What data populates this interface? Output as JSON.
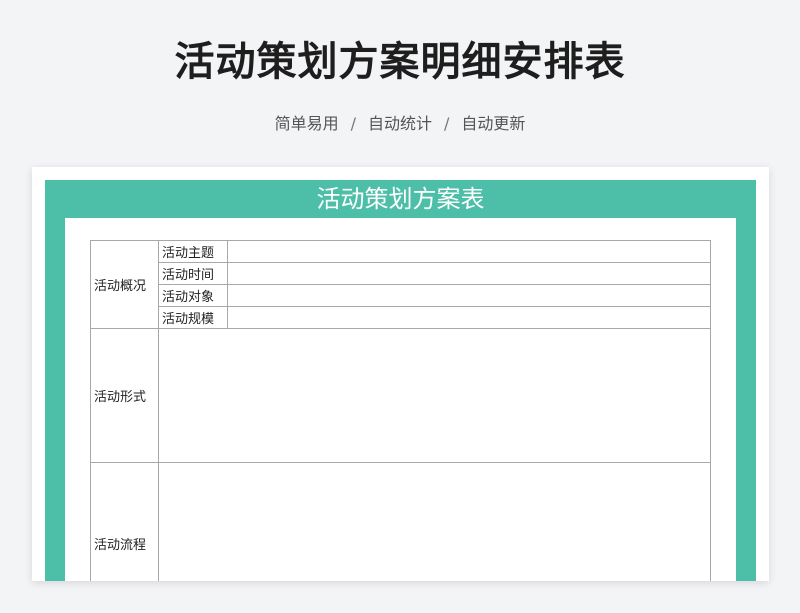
{
  "header": {
    "title": "活动策划方案明细安排表",
    "subtitle_parts": [
      "简单易用",
      "自动统计",
      "自动更新"
    ],
    "separator": "/"
  },
  "sheet": {
    "title": "活动策划方案表",
    "accent_color": "#4dbfa9",
    "sections": {
      "overview": {
        "label": "活动概况",
        "items": [
          "活动主题",
          "活动时间",
          "活动对象",
          "活动规模"
        ]
      },
      "format": {
        "label": "活动形式"
      },
      "process": {
        "label": "活动流程"
      }
    }
  }
}
